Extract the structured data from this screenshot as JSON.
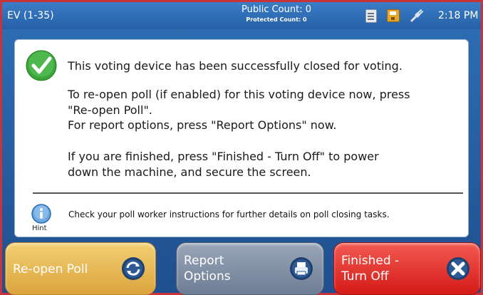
{
  "header": {
    "device_id": "EV (1-35)",
    "public_count": "Public Count: 0",
    "protected_count": "Protected Count: 0",
    "time": "2:18 PM",
    "icons": [
      "document-icon",
      "disk-icon",
      "plug-icon"
    ]
  },
  "panel": {
    "line1": "This voting device has been successfully closed for voting.",
    "reopen_line_a": "To re-open poll (if enabled) for this voting device now, press",
    "reopen_line_b": "\"Re-open Poll\".",
    "report_line": "For report options, press \"Report Options\" now.",
    "finish_line_a": "If you are finished, press \"Finished - Turn Off\" to power",
    "finish_line_b": "down the machine, and secure the screen.",
    "hint_label": "Hint",
    "hint_text": "Check your poll worker instructions for further details on poll closing tasks."
  },
  "buttons": {
    "reopen": "Re-open Poll",
    "report_a": "Report",
    "report_b": "Options",
    "finish_a": "Finished -",
    "finish_b": "Turn Off"
  },
  "colors": {
    "topbar": "#2f6fb4",
    "reopen": "#e8b955",
    "report": "#8391a6",
    "finish": "#e0322c"
  }
}
